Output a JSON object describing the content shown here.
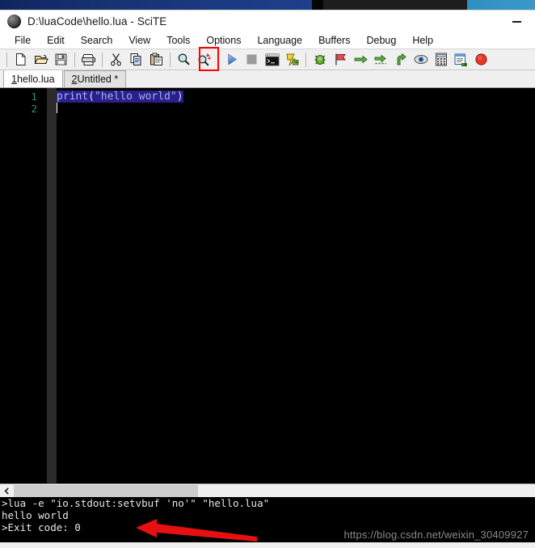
{
  "window": {
    "title": "D:\\luaCode\\hello.lua - SciTE",
    "app_icon": "scite-globe-icon",
    "minimize_label": "—"
  },
  "menubar": {
    "items": [
      {
        "label": "File",
        "name": "menu-file"
      },
      {
        "label": "Edit",
        "name": "menu-edit"
      },
      {
        "label": "Search",
        "name": "menu-search"
      },
      {
        "label": "View",
        "name": "menu-view"
      },
      {
        "label": "Tools",
        "name": "menu-tools"
      },
      {
        "label": "Options",
        "name": "menu-options"
      },
      {
        "label": "Language",
        "name": "menu-language"
      },
      {
        "label": "Buffers",
        "name": "menu-buffers"
      },
      {
        "label": "Debug",
        "name": "menu-debug"
      },
      {
        "label": "Help",
        "name": "menu-help"
      }
    ]
  },
  "toolbar": {
    "buttons": [
      {
        "name": "new-file-icon",
        "title": "New"
      },
      {
        "name": "open-file-icon",
        "title": "Open"
      },
      {
        "name": "save-file-icon",
        "title": "Save"
      },
      {
        "name": "print-icon",
        "title": "Print"
      },
      {
        "name": "cut-icon",
        "title": "Cut"
      },
      {
        "name": "copy-icon",
        "title": "Copy"
      },
      {
        "name": "paste-icon",
        "title": "Paste"
      },
      {
        "name": "find-icon",
        "title": "Find"
      },
      {
        "name": "replace-icon",
        "title": "Replace"
      },
      {
        "name": "go-run-icon",
        "title": "Go"
      },
      {
        "name": "stop-execute-icon",
        "title": "Stop Executing"
      },
      {
        "name": "console-icon",
        "title": "Console"
      },
      {
        "name": "compile-icon",
        "title": "Compile"
      },
      {
        "name": "debug-start-icon",
        "title": "Start Debug"
      },
      {
        "name": "debug-break-icon",
        "title": "Break"
      },
      {
        "name": "step-over-icon",
        "title": "Step Over"
      },
      {
        "name": "step-into-icon",
        "title": "Step Into"
      },
      {
        "name": "step-out-icon",
        "title": "Step Out"
      },
      {
        "name": "watch-icon",
        "title": "Watch"
      },
      {
        "name": "calculator-icon",
        "title": "Evaluate"
      },
      {
        "name": "stack-window-icon",
        "title": "Call Stack"
      },
      {
        "name": "debug-stop-icon",
        "title": "Stop Debug"
      }
    ],
    "highlight": {
      "target": "go-run-icon",
      "color": "#ff0000"
    }
  },
  "tabs": {
    "items": [
      {
        "num": "1",
        "label": " hello.lua",
        "active": true,
        "name": "tab-hello-lua"
      },
      {
        "num": "2",
        "label": " Untitled *",
        "active": false,
        "name": "tab-untitled"
      }
    ]
  },
  "editor": {
    "line_numbers": [
      "1",
      "2"
    ],
    "code": {
      "fn": "print",
      "open_paren": "(",
      "string": "\"hello world\"",
      "close_paren": ")"
    },
    "full_line": "print(\"hello world\")",
    "selection": true,
    "background": "#000000",
    "linenumber_color": "#2e8b77",
    "selection_color": "#2a1f8c"
  },
  "output": {
    "scroll_left_icon": "chevron-left-icon",
    "lines": [
      ">lua -e \"io.stdout:setvbuf 'no'\" \"hello.lua\"",
      "hello world",
      ">Exit code: 0"
    ],
    "background": "#000000"
  },
  "annotations": {
    "arrow": {
      "name": "red-arrow-annotation",
      "color": "#e61010",
      "points_at": "hello world"
    },
    "watermark": "https://blog.csdn.net/weixin_30409927"
  }
}
